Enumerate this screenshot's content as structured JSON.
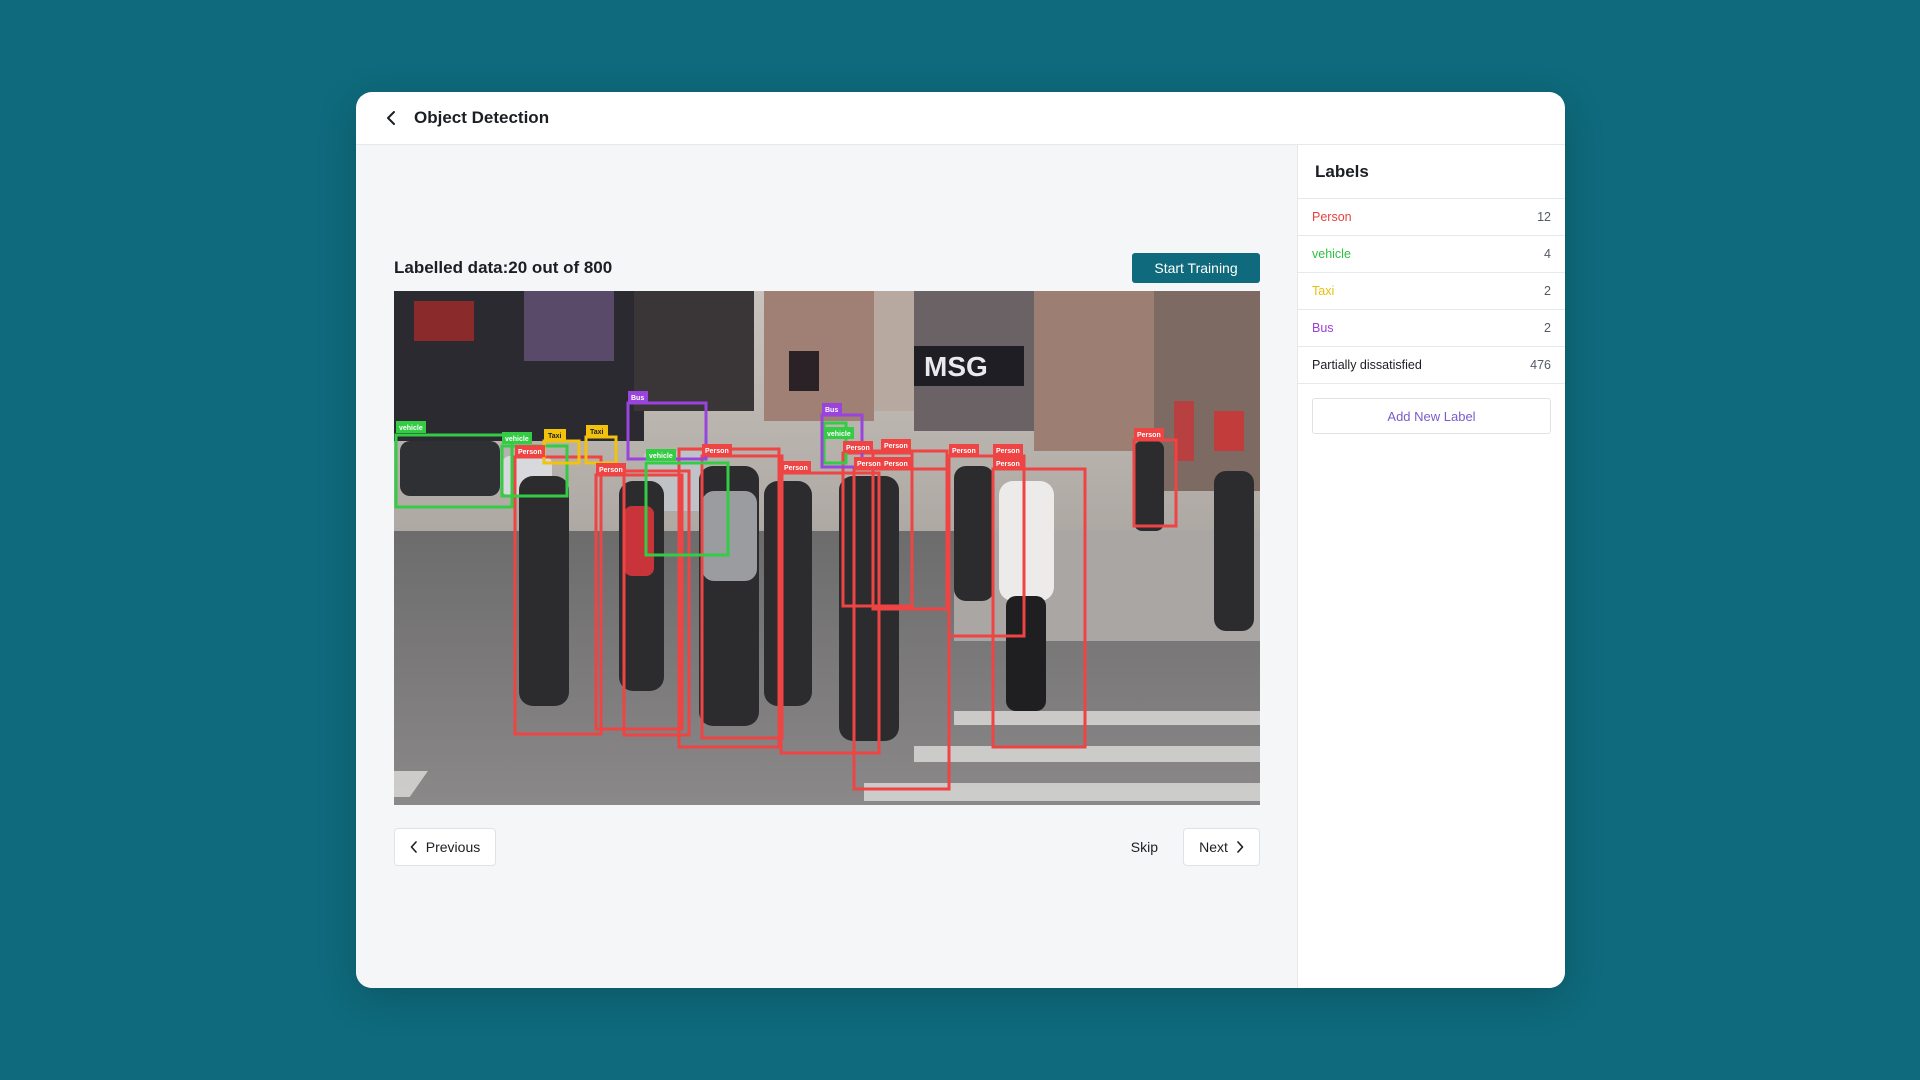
{
  "window": {
    "title": "Object Detection"
  },
  "progress": {
    "text": "Labelled data:20 out of 800",
    "labelled": 20,
    "total": 800
  },
  "actions": {
    "start_training": "Start Training",
    "previous": "Previous",
    "skip": "Skip",
    "next": "Next"
  },
  "colors": {
    "background": "#0e6a7c",
    "primary": "#0e6a7c",
    "person": "#ee4444",
    "vehicle": "#33cc44",
    "taxi": "#f2c20c",
    "bus": "#9944dd"
  },
  "sidebar": {
    "title": "Labels",
    "labels": [
      {
        "name": "Person",
        "count": "12",
        "color": "#e8423f"
      },
      {
        "name": "vehicle",
        "count": "4",
        "color": "#2fbf3f"
      },
      {
        "name": "Taxi",
        "count": "2",
        "color": "#e8c010"
      },
      {
        "name": "Bus",
        "count": "2",
        "color": "#9a3fd6"
      },
      {
        "name": "Partially dissatisfied",
        "count": "476",
        "color": "#1b1f24"
      }
    ],
    "add_label": "Add New Label"
  },
  "annotations": {
    "tag_person": "Person",
    "tag_vehicle": "vehicle",
    "tag_taxi": "Taxi",
    "tag_bus": "Bus"
  }
}
